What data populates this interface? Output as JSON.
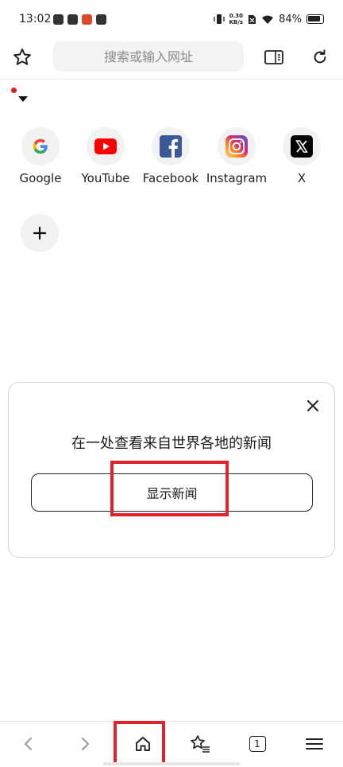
{
  "status_bar": {
    "time": "13:02",
    "net_speed_value": "0.30",
    "net_speed_unit": "KB/s",
    "battery": "84%"
  },
  "toolbar": {
    "url_placeholder": "搜索或输入网址"
  },
  "shortcuts": [
    {
      "label": "Google",
      "icon": "google-icon"
    },
    {
      "label": "YouTube",
      "icon": "youtube-icon"
    },
    {
      "label": "Facebook",
      "icon": "facebook-icon"
    },
    {
      "label": "Instagram",
      "icon": "instagram-icon"
    },
    {
      "label": "X",
      "icon": "x-icon"
    }
  ],
  "news_card": {
    "title": "在一处查看来自世界各地的新闻",
    "button_label": "显示新闻"
  },
  "bottom_nav": {
    "tab_count": "1"
  },
  "colors": {
    "highlight": "#e0222b",
    "accent_red": "#e02020"
  }
}
